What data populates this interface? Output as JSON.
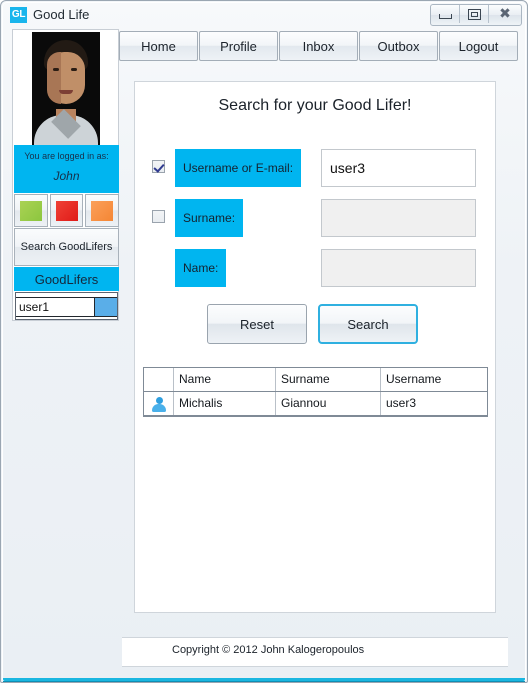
{
  "window": {
    "title": "Good Life",
    "logo_text": "GL",
    "controls": [
      {
        "name": "minimize",
        "label": "—"
      },
      {
        "name": "maximize",
        "label": "□"
      },
      {
        "name": "close",
        "label": "✖"
      }
    ],
    "accent_color": "#1ab6e0"
  },
  "nav": {
    "tabs": [
      {
        "label": "Home"
      },
      {
        "label": "Profile"
      },
      {
        "label": "Inbox"
      },
      {
        "label": "Outbox"
      },
      {
        "label": "Logout"
      }
    ]
  },
  "sidebar": {
    "logged_in_label": "You are logged in as:",
    "logged_in_user": "John",
    "color_buttons": [
      {
        "name": "green",
        "color": "#8cc63f"
      },
      {
        "name": "red",
        "color": "#e01b18"
      },
      {
        "name": "orange",
        "color": "#f58634"
      }
    ],
    "search_goodlifers_label": "Search GoodLifers",
    "goodlifers_header": "GoodLifers",
    "goodlifers_list": [
      {
        "name": "user1",
        "color": "#5aaee8"
      }
    ]
  },
  "main": {
    "title": "Search for your Good Lifer!",
    "fields": [
      {
        "label": "Username or E-mail:",
        "value": "user3",
        "checkbox": true,
        "checked": true,
        "enabled": true
      },
      {
        "label": "Surname:",
        "value": "",
        "checkbox": true,
        "checked": false,
        "enabled": false
      },
      {
        "label": "Name:",
        "value": "",
        "checkbox": false,
        "checked": false,
        "enabled": false
      }
    ],
    "buttons": {
      "reset": "Reset",
      "search": "Search"
    },
    "results": {
      "columns": [
        "",
        "Name",
        "Surname",
        "Username"
      ],
      "rows": [
        {
          "icon": "user-avatar-icon",
          "name": "Michalis",
          "surname": "Giannou",
          "username": "user3"
        }
      ]
    }
  },
  "footer": {
    "copyright": "Copyright © 2012 John Kalogeropoulos"
  }
}
